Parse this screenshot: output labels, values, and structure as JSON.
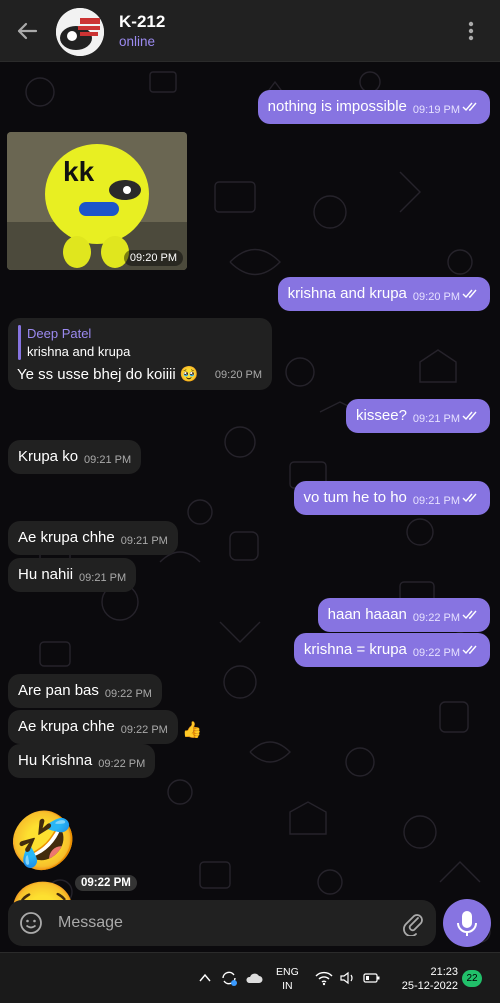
{
  "header": {
    "title": "K-212",
    "status": "online"
  },
  "messages": [
    {
      "dir": "out",
      "text": "nothing is impossible",
      "time": "09:19 PM"
    },
    {
      "dir": "in",
      "type": "sticker",
      "sticker_text": "kk",
      "time": "09:20 PM"
    },
    {
      "dir": "out",
      "text": "krishna and krupa",
      "time": "09:20 PM"
    },
    {
      "dir": "in",
      "reply_to": {
        "name": "Deep Patel",
        "text": "krishna and krupa"
      },
      "text": "Ye ss usse bhej do koiiii 🥹",
      "time": "09:20 PM"
    },
    {
      "dir": "out",
      "text": "kissee?",
      "time": "09:21 PM"
    },
    {
      "dir": "in",
      "text": "Krupa ko",
      "time": "09:21 PM"
    },
    {
      "dir": "out",
      "text": "vo tum he to ho",
      "time": "09:21 PM"
    },
    {
      "dir": "in",
      "text": "Ae krupa chhe",
      "time": "09:21 PM"
    },
    {
      "dir": "in",
      "text": "Hu  nahii",
      "time": "09:21 PM"
    },
    {
      "dir": "out",
      "text": "haan haaan",
      "time": "09:22 PM"
    },
    {
      "dir": "out",
      "text": "krishna = krupa",
      "time": "09:22 PM"
    },
    {
      "dir": "in",
      "text": "Are pan bas",
      "time": "09:22 PM"
    },
    {
      "dir": "in",
      "text": "Ae krupa chhe",
      "time": "09:22 PM",
      "reaction": "👍"
    },
    {
      "dir": "in",
      "text": "Hu Krishna",
      "time": "09:22 PM"
    },
    {
      "dir": "in",
      "type": "emoji",
      "text": "🤣😂",
      "time": "09:22 PM"
    }
  ],
  "composer": {
    "placeholder": "Message"
  },
  "taskbar": {
    "lang_line1": "ENG",
    "lang_line2": "IN",
    "time": "21:23",
    "date": "25-12-2022",
    "notifications": "22"
  },
  "colors": {
    "accent": "#8774e1",
    "incoming_bubble": "#212121",
    "background": "#0b0a0d",
    "online": "#9b8af0"
  },
  "icons": [
    "back-arrow-icon",
    "more-vertical-icon",
    "read-ticks-icon",
    "smile-icon",
    "paperclip-icon",
    "microphone-icon",
    "chevron-up-icon",
    "sync-icon",
    "cloud-icon",
    "wifi-icon",
    "volume-icon",
    "battery-icon"
  ]
}
